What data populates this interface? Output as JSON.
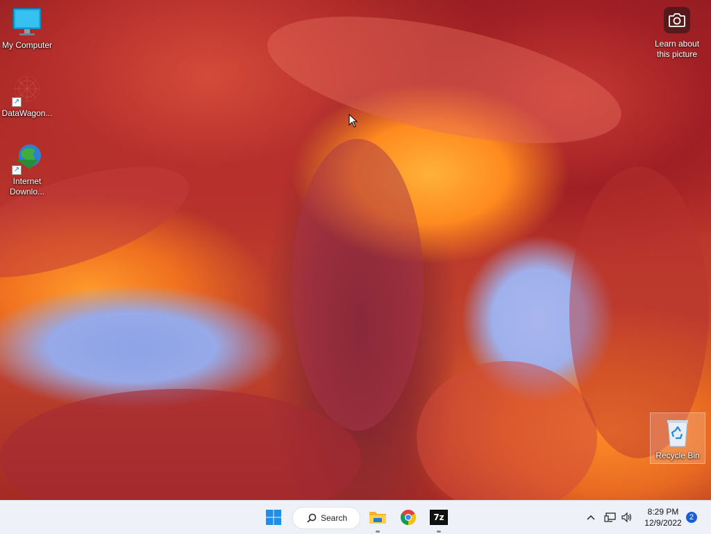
{
  "desktop": {
    "icons": [
      {
        "label": "My Computer",
        "icon": "monitor-icon"
      },
      {
        "label": "DataWagon...",
        "icon": "datawagon-icon"
      },
      {
        "label": "Internet\nDownlo...",
        "icon": "internet-download-manager-icon"
      }
    ],
    "recycle_bin": {
      "label": "Recycle Bin",
      "icon": "recycle-bin-icon"
    },
    "learn_picture": {
      "label": "Learn about\nthis picture",
      "icon": "camera-icon"
    }
  },
  "taskbar": {
    "search_label": "Search",
    "apps": [
      {
        "name": "start",
        "icon": "windows-start-icon"
      },
      {
        "name": "file-explorer",
        "icon": "folder-icon",
        "running": true
      },
      {
        "name": "chrome",
        "icon": "chrome-icon",
        "running": false
      },
      {
        "name": "7-zip",
        "icon": "7zip-icon",
        "label": "7z",
        "running": true
      }
    ],
    "tray": {
      "time": "8:29 PM",
      "date": "12/9/2022",
      "notification_count": "2"
    }
  },
  "colors": {
    "taskbar_bg": "#eef1f7",
    "accent": "#1a5fd1"
  }
}
